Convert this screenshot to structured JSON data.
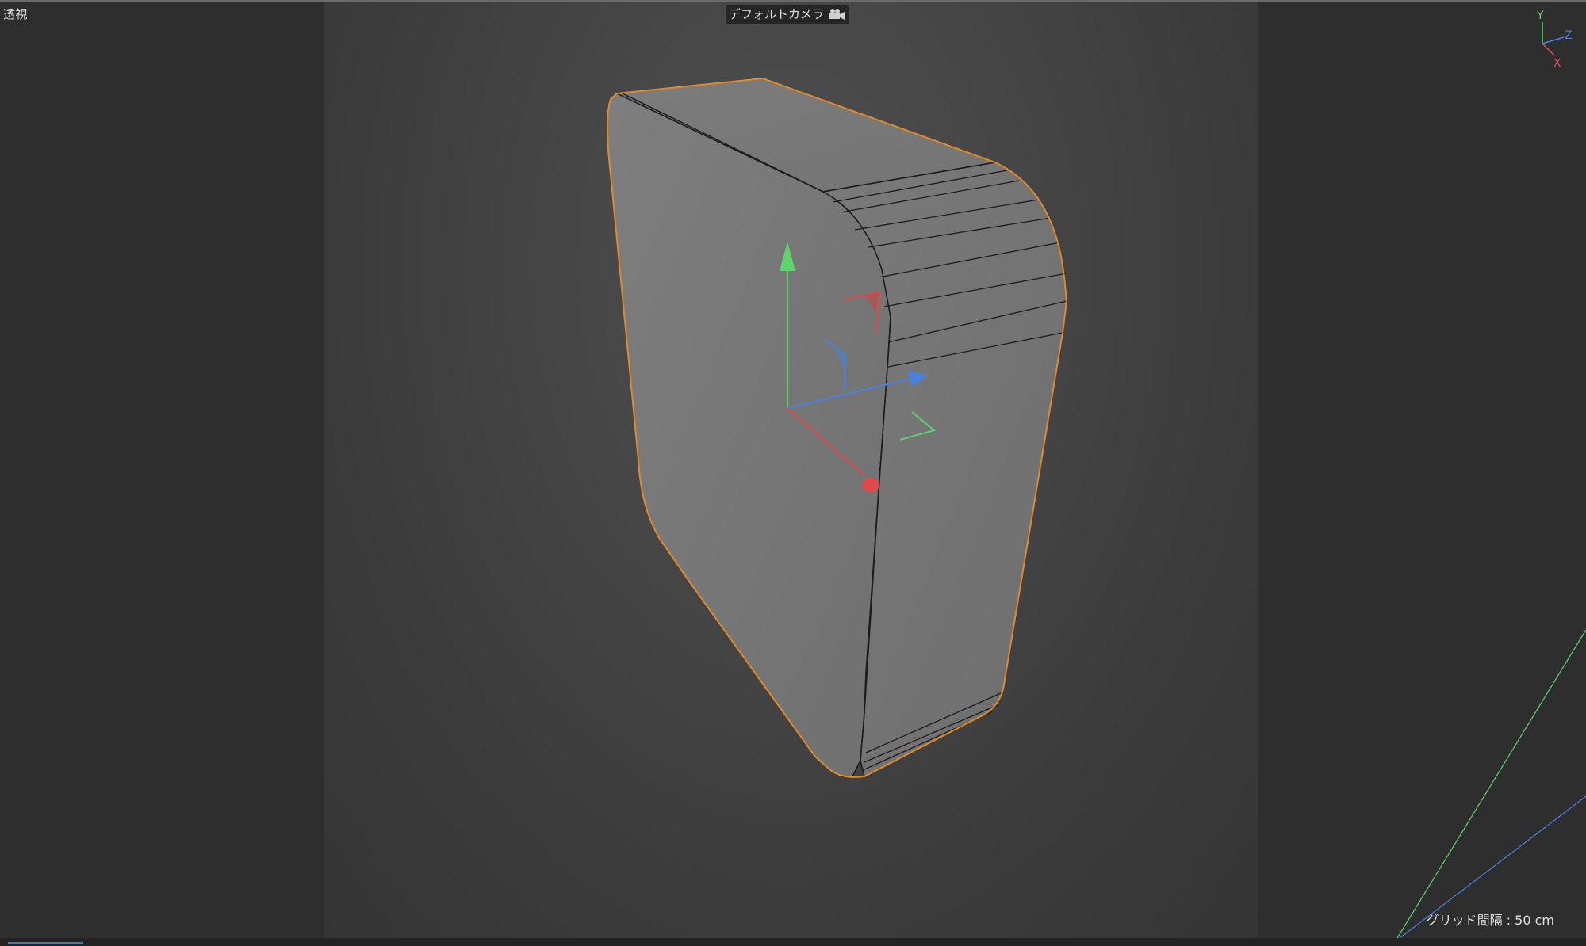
{
  "viewport": {
    "view_name": "透視",
    "camera_name": "デフォルトカメラ",
    "grid_spacing": "グリッド間隔 : 50 cm"
  },
  "axis_indicator": {
    "y_label": "Y",
    "z_label": "Z",
    "x_label": "X"
  },
  "colors": {
    "x_axis": "#e24a4a",
    "y_axis": "#5fd46e",
    "z_axis": "#4a82e2",
    "selection_outline": "#e08a2e",
    "model_face": "#7a7a7a"
  }
}
